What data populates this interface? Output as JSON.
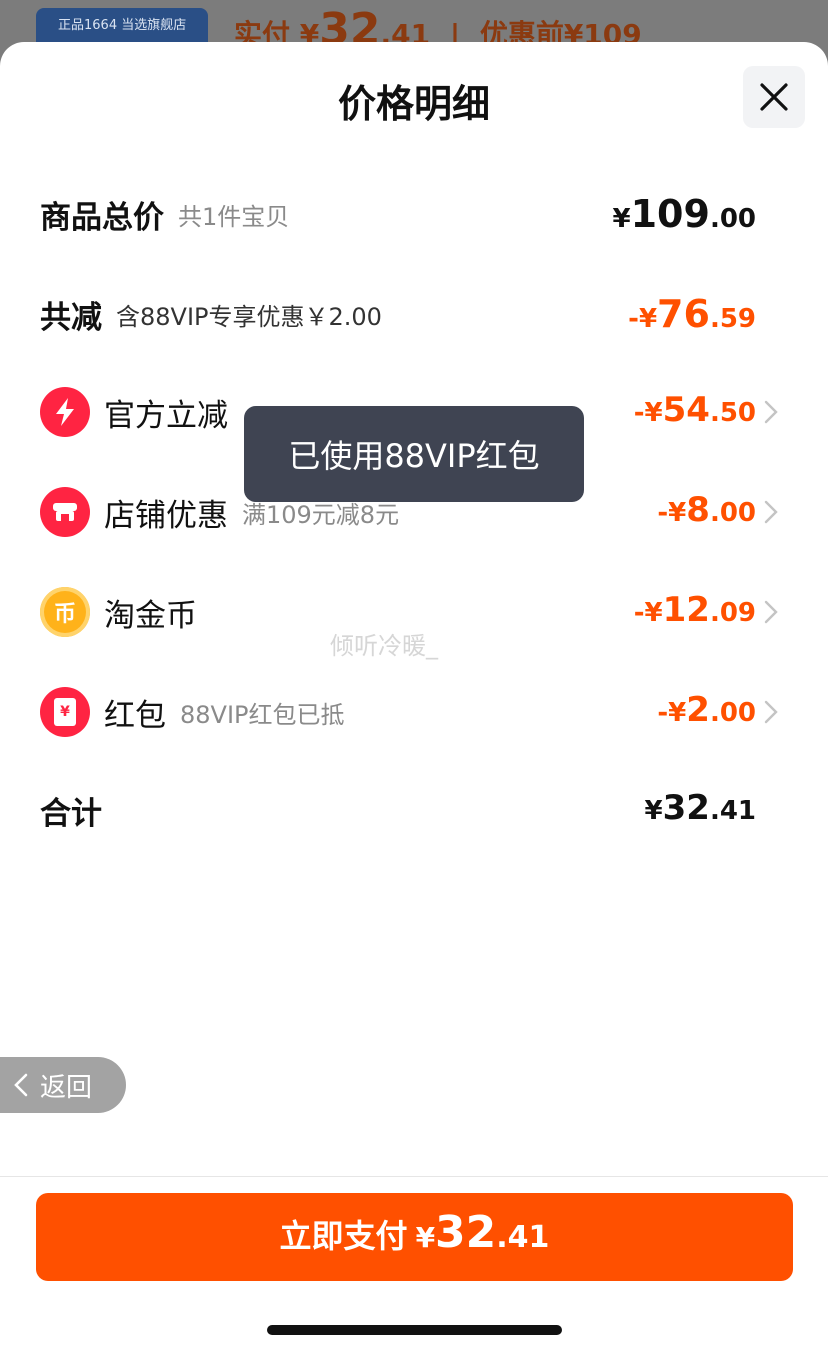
{
  "background": {
    "store_badge": "正品1664 当选旗舰店",
    "paid_label": "实付",
    "paid_symbol": "¥",
    "paid_int": "32",
    "paid_dec": ".41",
    "before_discount_label": "优惠前¥109"
  },
  "sheet": {
    "title": "价格明细"
  },
  "rows": {
    "total": {
      "label": "商品总价",
      "sub": "共1件宝贝",
      "symbol": "¥",
      "int": "109",
      "dec": ".00"
    },
    "discount": {
      "label": "共减",
      "sub": "含88VIP专享优惠￥2.00",
      "symbol": "-¥",
      "int": "76",
      "dec": ".59"
    },
    "official": {
      "label": "官方立减",
      "symbol": "-¥",
      "int": "54",
      "dec": ".50"
    },
    "store": {
      "label": "店铺优惠",
      "sub": "满109元减8元",
      "symbol": "-¥",
      "int": "8",
      "dec": ".00"
    },
    "coins": {
      "label": "淘金币",
      "icon_glyph": "币",
      "symbol": "-¥",
      "int": "12",
      "dec": ".09"
    },
    "redpacket": {
      "label": "红包",
      "sub": "88VIP红包已抵",
      "icon_glyph": "¥",
      "symbol": "-¥",
      "int": "2",
      "dec": ".00"
    },
    "sum": {
      "label": "合计",
      "symbol": "¥",
      "int": "32",
      "dec": ".41"
    }
  },
  "toast": "已使用88VIP红包",
  "watermark": "倾听冷暖_",
  "back": "返回",
  "pay": {
    "label": "立即支付",
    "symbol": "¥",
    "int": "32",
    "dec": ".41"
  },
  "colors": {
    "accent": "#ff5000",
    "toast_bg": "#3f4452",
    "icon_red": "#ff2442",
    "coin_gold": "#ffb21a"
  }
}
